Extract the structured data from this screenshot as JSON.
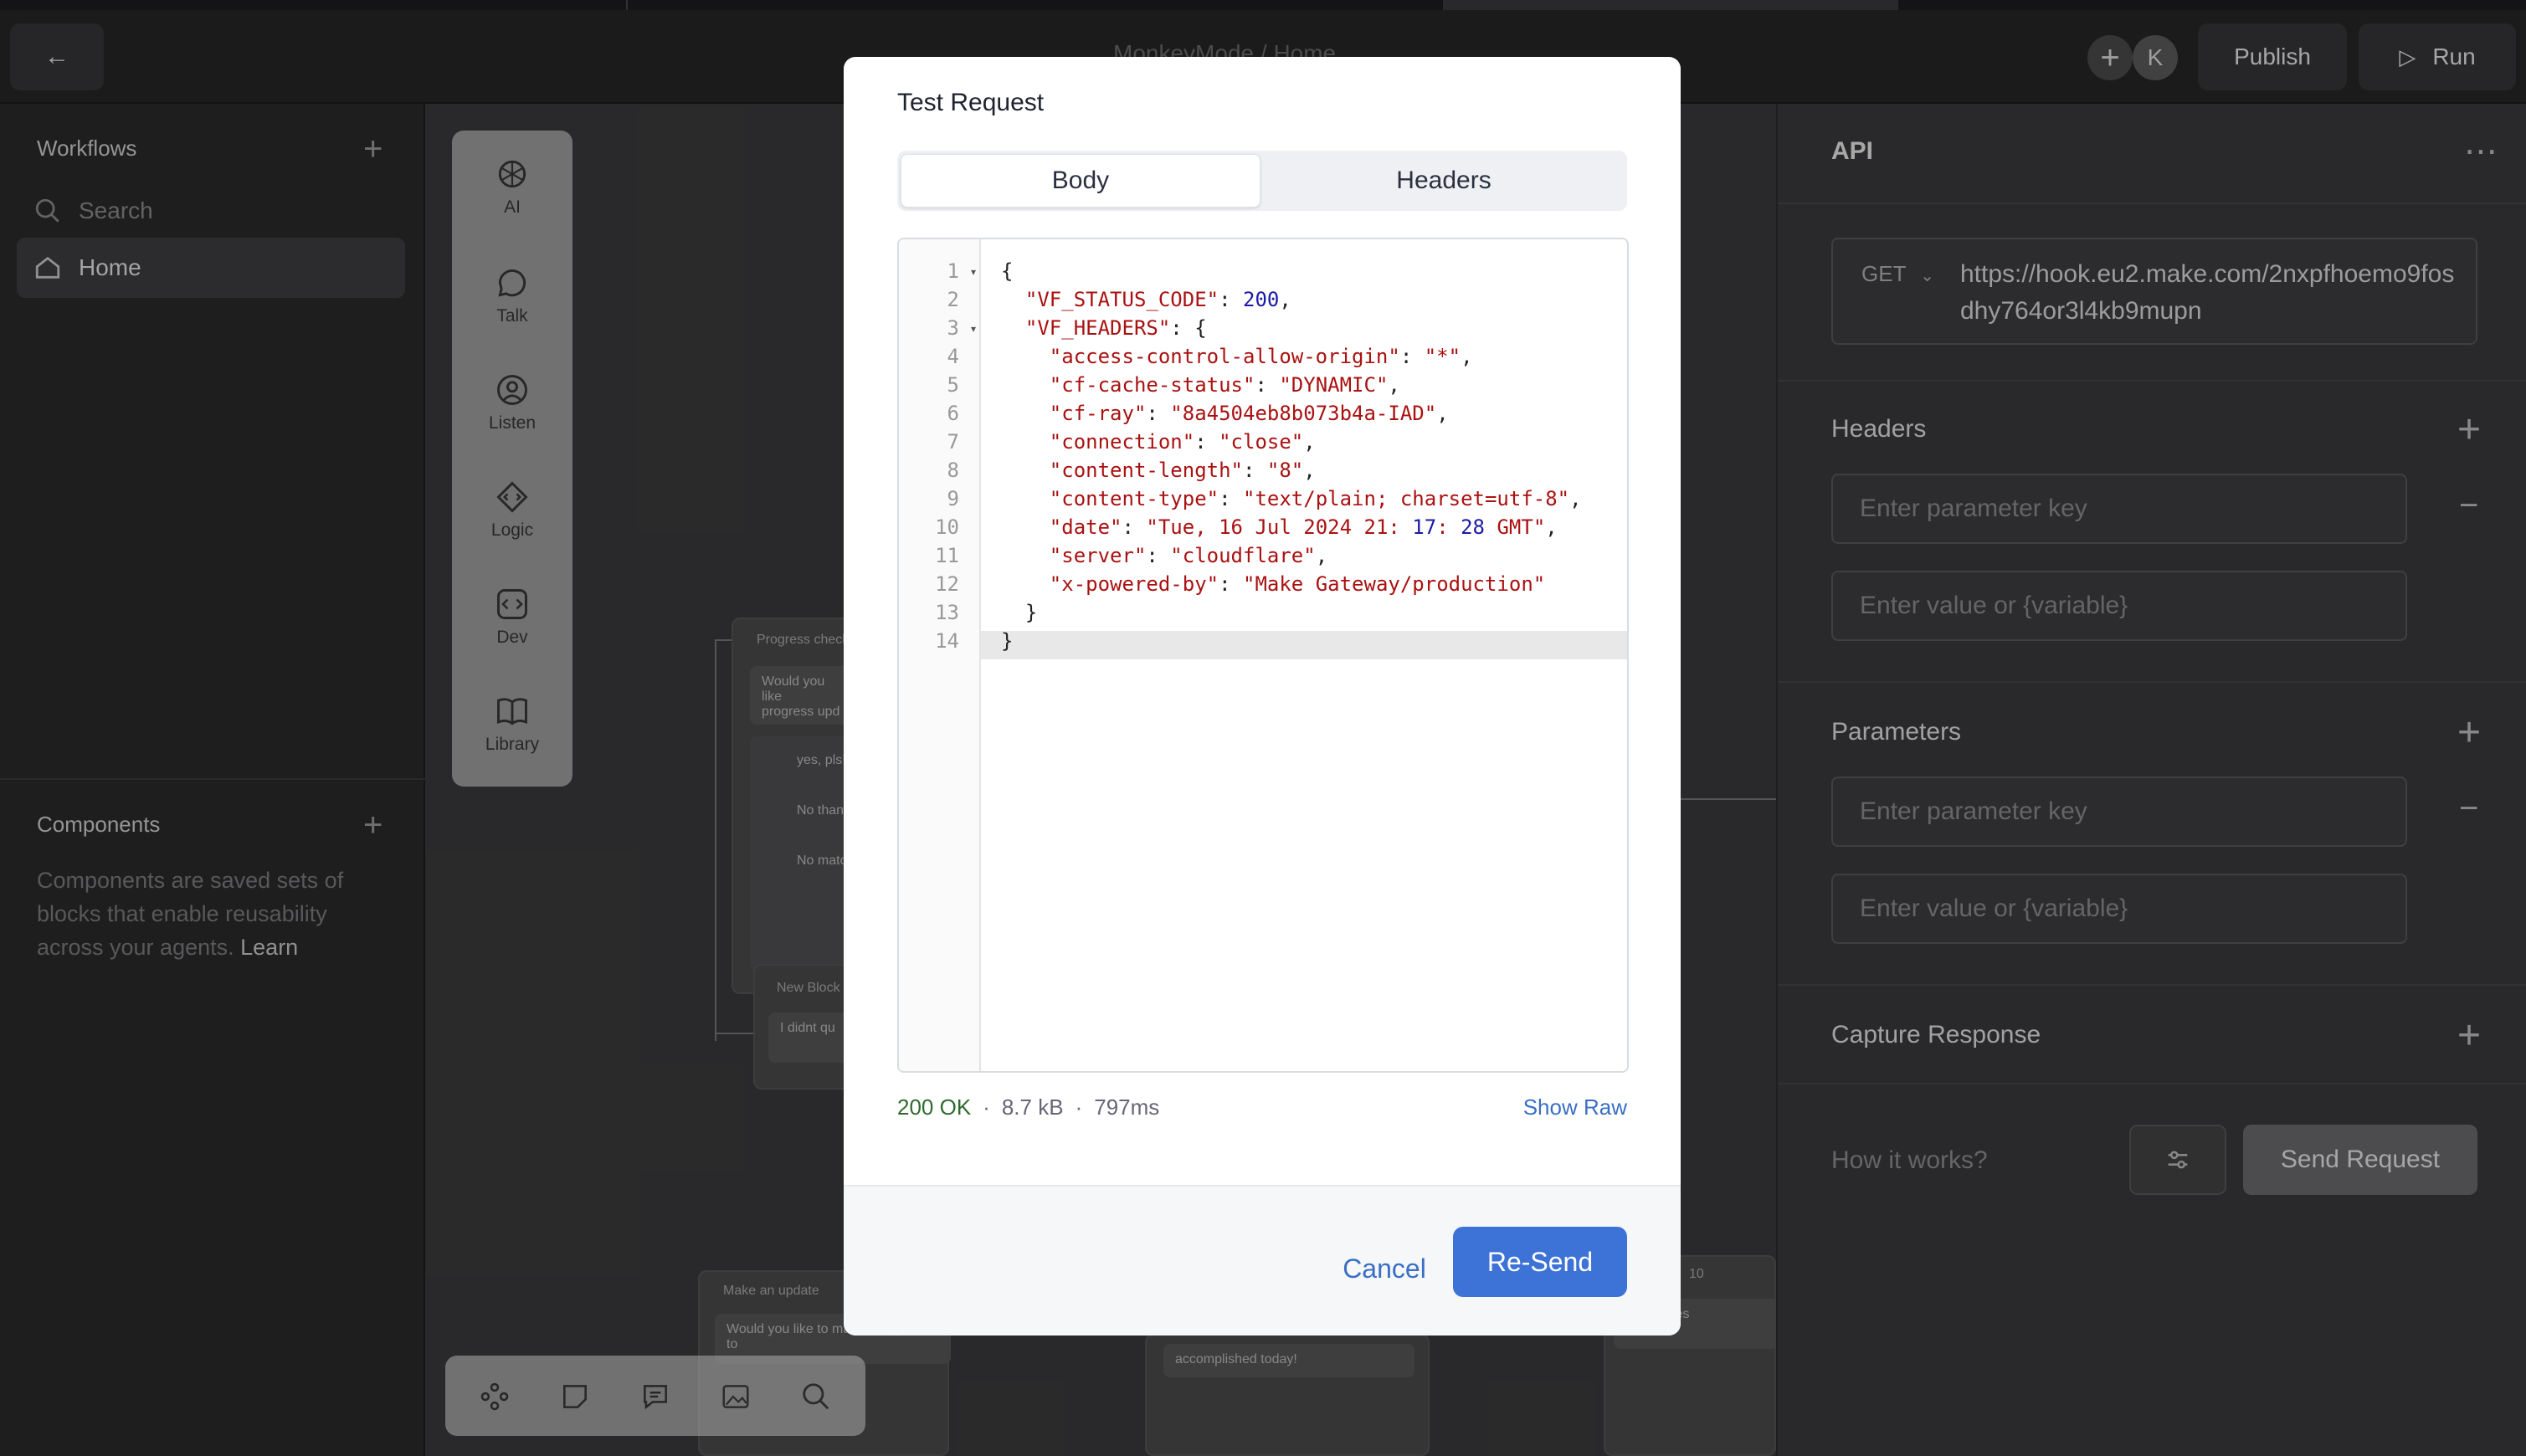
{
  "topbar": {
    "breadcrumb_project": "MonkeyMode",
    "breadcrumb_sep": "/",
    "breadcrumb_page": "Home",
    "avatar_letter": "K",
    "publish_label": "Publish",
    "run_label": "Run"
  },
  "sidebar": {
    "workflows_label": "Workflows",
    "search_placeholder": "Search",
    "items": [
      {
        "label": "Home"
      }
    ],
    "components_label": "Components",
    "components_text": "Components are saved sets of blocks that enable reusability across your agents.",
    "learn_label": "Learn"
  },
  "palette": {
    "tools": [
      {
        "label": "AI",
        "icon": "openai-icon"
      },
      {
        "label": "Talk",
        "icon": "speech-bubble-icon"
      },
      {
        "label": "Listen",
        "icon": "listen-icon"
      },
      {
        "label": "Logic",
        "icon": "logic-icon"
      },
      {
        "label": "Dev",
        "icon": "code-icon"
      },
      {
        "label": "Library",
        "icon": "book-icon"
      }
    ]
  },
  "canvas": {
    "nodes": [
      {
        "title": "Progress check",
        "texts": [
          "Would you like",
          "progress upd"
        ],
        "options": [
          "yes, pls!",
          "No thank",
          "No matc"
        ]
      },
      {
        "title": "New Block",
        "texts": [
          "I didnt qu"
        ]
      },
      {
        "title": "Make an update",
        "texts": [
          "Would you like to make an update to"
        ]
      },
      {
        "title": "",
        "texts": [
          "accomplished today!"
        ]
      },
      {
        "title": "10",
        "texts": [
          "act entities"
        ]
      }
    ]
  },
  "right_panel": {
    "title": "API",
    "method": "GET",
    "url": "https://hook.eu2.make.com/2nxpfhoemo9fosdhy764or3l4kb9mupn",
    "headers_label": "Headers",
    "header_key_placeholder": "Enter parameter key",
    "header_value_placeholder": "Enter value or {variable}",
    "parameters_label": "Parameters",
    "param_key_placeholder": "Enter parameter key",
    "param_value_placeholder": "Enter value or {variable}",
    "capture_label": "Capture Response",
    "how_it_works": "How it works?",
    "send_label": "Send Request"
  },
  "modal": {
    "title": "Test Request",
    "tabs": [
      "Body",
      "Headers"
    ],
    "active_tab": "Body",
    "code_lines": [
      "{",
      "  \"VF_STATUS_CODE\": 200,",
      "  \"VF_HEADERS\": {",
      "    \"access-control-allow-origin\": \"*\",",
      "    \"cf-cache-status\": \"DYNAMIC\",",
      "    \"cf-ray\": \"8a4504eb8b073b4a-IAD\",",
      "    \"connection\": \"close\",",
      "    \"content-length\": \"8\",",
      "    \"content-type\": \"text/plain; charset=utf-8\",",
      "    \"date\": \"Tue, 16 Jul 2024 21:17:28 GMT\",",
      "    \"server\": \"cloudflare\",",
      "    \"x-powered-by\": \"Make Gateway/production\"",
      "  }",
      "}"
    ],
    "status_code": "200 OK",
    "dot": "·",
    "size": "8.7 kB",
    "time": "797ms",
    "show_raw": "Show Raw",
    "cancel_label": "Cancel",
    "resend_label": "Re-Send"
  }
}
